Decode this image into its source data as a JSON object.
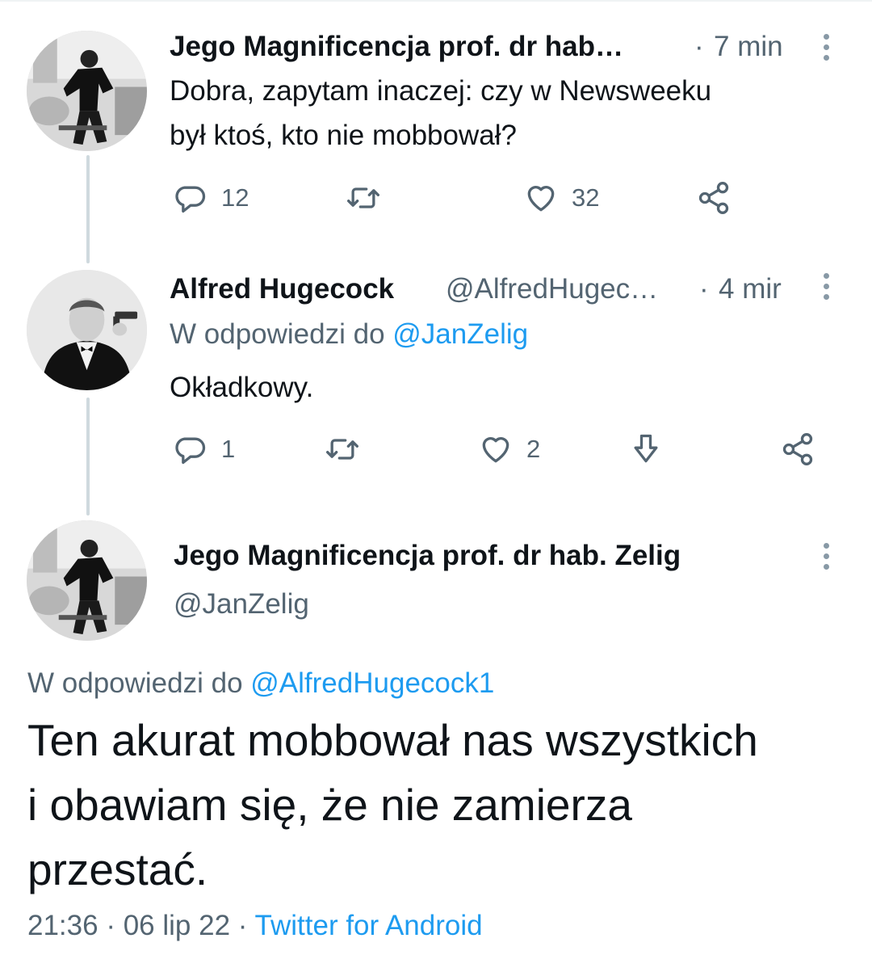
{
  "colors": {
    "accent": "#1d9bf0",
    "muted": "#536471",
    "text": "#0f1419",
    "thread_line": "#cfd9de"
  },
  "tweets": [
    {
      "display_name": "Jego Magnificencja prof. dr hab…",
      "separator": "·",
      "time": "7 min",
      "text_lines": [
        "Dobra, zapytam inaczej: czy w Newsweeku",
        "był ktoś, kto nie mobbował?"
      ],
      "actions": {
        "reply_count": "12",
        "retweet_count": "",
        "like_count": "32"
      },
      "icons": [
        "reply-icon",
        "retweet-icon",
        "like-icon",
        "share-icon"
      ]
    },
    {
      "display_name": "Alfred Hugecock",
      "handle": "@AlfredHugec…",
      "separator": "·",
      "time": "4 mir",
      "reply_prefix": "W odpowiedzi do",
      "reply_to": "@JanZelig",
      "text": "Okładkowy.",
      "actions": {
        "reply_count": "1",
        "retweet_count": "",
        "like_count": "2"
      },
      "icons": [
        "reply-icon",
        "retweet-icon",
        "like-icon",
        "downvote-icon",
        "share-icon"
      ]
    }
  ],
  "focused": {
    "display_name": "Jego Magnificencja prof. dr hab. Zelig",
    "handle": "@JanZelig",
    "reply_prefix": "W odpowiedzi do",
    "reply_to": "@AlfredHugecock1",
    "text_lines": [
      "Ten akurat mobbował nas wszystkich",
      "i obawiam się, że nie zamierza",
      "przestać."
    ],
    "time": "21:36",
    "separator": "·",
    "date": "06 lip 22",
    "source": "Twitter for Android"
  }
}
